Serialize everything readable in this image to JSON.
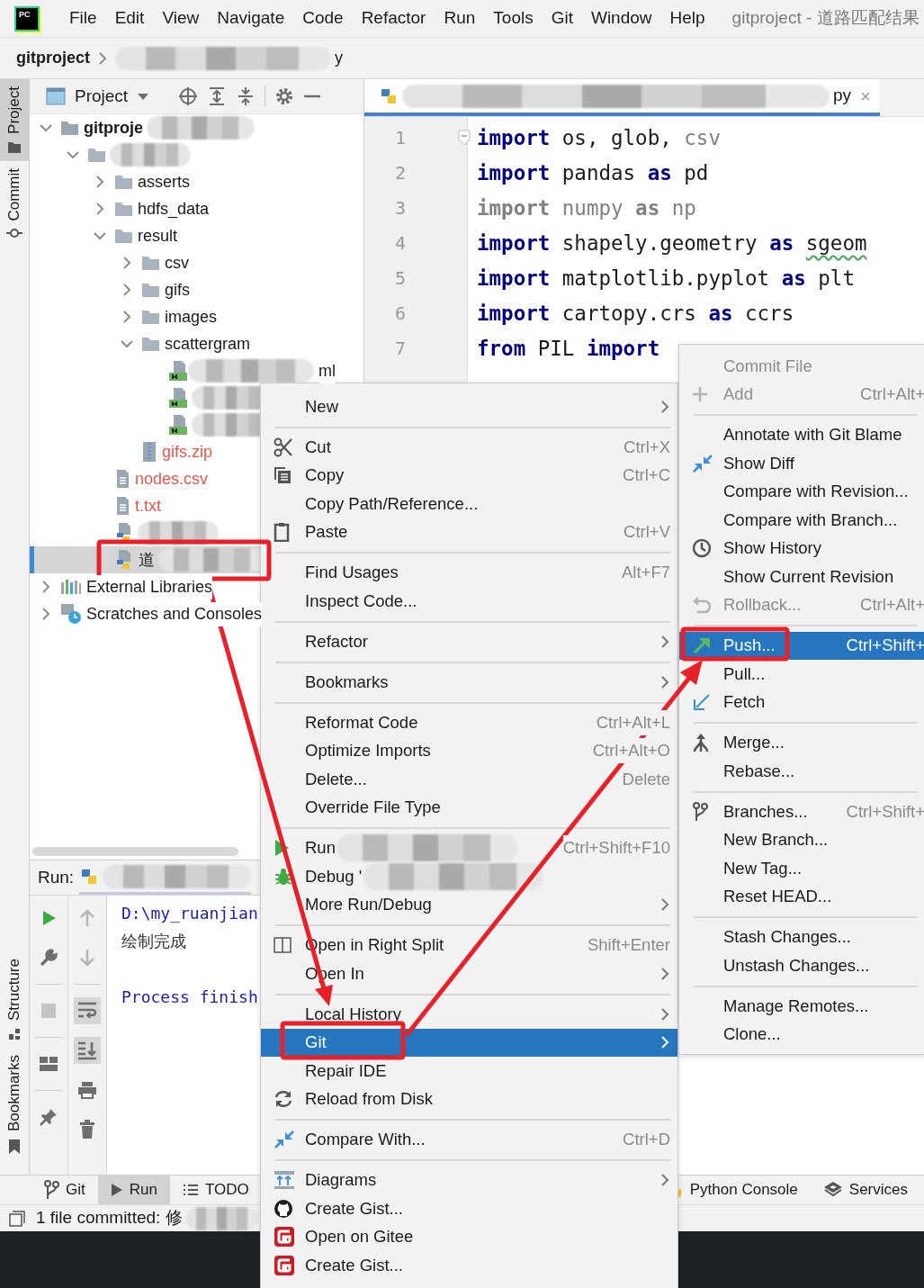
{
  "menu_bar": {
    "logo_text": "PC",
    "items": [
      "File",
      "Edit",
      "View",
      "Navigate",
      "Code",
      "Refactor",
      "Run",
      "Tools",
      "Git",
      "Window",
      "Help"
    ],
    "title": "gitproject - 道路匹配结果"
  },
  "breadcrumb": [
    {
      "label": "gitproject"
    },
    {
      "label": "y",
      "redacted_before": true
    }
  ],
  "left_toolbar": {
    "top": [
      {
        "label": "Project",
        "selected": true
      },
      {
        "label": "Commit",
        "selected": false
      }
    ],
    "bottom": [
      {
        "label": "Structure"
      },
      {
        "label": "Bookmarks"
      }
    ]
  },
  "project_panel": {
    "title": "Project",
    "tree": [
      {
        "label": "gitproje",
        "kind": "project",
        "expanded": true,
        "selected": false,
        "redacted_after": true,
        "children": [
          {
            "kind": "folder",
            "expanded": true,
            "selected": false,
            "redacted_after": true,
            "children": [
              {
                "label": "asserts",
                "kind": "folder",
                "expanded": false,
                "selected": false
              },
              {
                "label": "hdfs_data",
                "kind": "folder",
                "expanded": false,
                "selected": false
              },
              {
                "label": "result",
                "kind": "folder",
                "expanded": true,
                "selected": false,
                "children": [
                  {
                    "label": "csv",
                    "kind": "folder",
                    "expanded": false,
                    "selected": false
                  },
                  {
                    "label": "gifs",
                    "kind": "folder",
                    "expanded": false,
                    "selected": false
                  },
                  {
                    "label": "images",
                    "kind": "folder",
                    "expanded": false,
                    "selected": false
                  },
                  {
                    "label": "scattergram",
                    "kind": "folder",
                    "expanded": true,
                    "selected": false,
                    "children": [
                      {
                        "label": "ml",
                        "kind": "html",
                        "selected": false,
                        "redacted_before": true
                      },
                      {
                        "kind": "html",
                        "selected": false,
                        "redacted_after": true
                      },
                      {
                        "kind": "html",
                        "selected": false,
                        "redacted_after": true
                      }
                    ]
                  },
                  {
                    "label": "gifs.zip",
                    "kind": "zip",
                    "selected": false,
                    "color": "#e5574d"
                  }
                ]
              },
              {
                "label": "nodes.csv",
                "kind": "text",
                "selected": false,
                "color": "#e5574d"
              },
              {
                "label": "t.txt",
                "kind": "text",
                "selected": false,
                "color": "#e5574d"
              },
              {
                "kind": "python",
                "selected": false,
                "redacted_after": true
              },
              {
                "label": "道",
                "kind": "python",
                "selected": true,
                "redacted_after": true
              }
            ]
          }
        ]
      },
      {
        "label": "External Libraries",
        "kind": "library",
        "expanded": false,
        "selected": false
      },
      {
        "label": "Scratches and Consoles",
        "kind": "scratch",
        "expanded": false,
        "selected": false
      }
    ]
  },
  "editor": {
    "tab": {
      "label": "py",
      "close": "×",
      "redacted_before": true
    },
    "lines": [
      {
        "number": "1",
        "tokens": [
          {
            "text": "import",
            "kind": "keyword"
          },
          {
            "text": " os, glob, ",
            "kind": "plain"
          },
          {
            "text": "csv",
            "kind": "unused"
          }
        ]
      },
      {
        "number": "2",
        "tokens": [
          {
            "text": "import",
            "kind": "keyword"
          },
          {
            "text": " pandas ",
            "kind": "plain"
          },
          {
            "text": "as",
            "kind": "keyword"
          },
          {
            "text": " pd",
            "kind": "plain"
          }
        ]
      },
      {
        "number": "3",
        "tokens": [
          {
            "text": "import",
            "kind": "unused_keyword"
          },
          {
            "text": " numpy ",
            "kind": "unused"
          },
          {
            "text": "as",
            "kind": "unused_keyword"
          },
          {
            "text": " np",
            "kind": "unused"
          }
        ]
      },
      {
        "number": "4",
        "tokens": [
          {
            "text": "import",
            "kind": "keyword"
          },
          {
            "text": " shapely.geometry ",
            "kind": "plain"
          },
          {
            "text": "as ",
            "kind": "keyword"
          },
          {
            "text": "sgeom",
            "kind": "warning"
          }
        ]
      },
      {
        "number": "5",
        "tokens": [
          {
            "text": "import",
            "kind": "keyword"
          },
          {
            "text": " matplotlib.pyplot ",
            "kind": "plain"
          },
          {
            "text": "as",
            "kind": "keyword"
          },
          {
            "text": " plt",
            "kind": "plain"
          }
        ]
      },
      {
        "number": "6",
        "tokens": [
          {
            "text": "import",
            "kind": "keyword"
          },
          {
            "text": " cartopy.crs ",
            "kind": "plain"
          },
          {
            "text": "as",
            "kind": "keyword"
          },
          {
            "text": " ccrs",
            "kind": "plain"
          }
        ]
      },
      {
        "number": "7",
        "tokens": [
          {
            "text": "from",
            "kind": "keyword"
          },
          {
            "text": " PIL ",
            "kind": "plain"
          },
          {
            "text": "import",
            "kind": "keyword"
          }
        ]
      }
    ]
  },
  "run_panel": {
    "title": "Run:",
    "console": [
      {
        "text": "D:\\my_ruanjian",
        "kind": "path"
      },
      {
        "text": "绘制完成",
        "kind": "output"
      },
      {
        "text": "Process finish",
        "kind": "info"
      }
    ]
  },
  "bottom_tool_bar": {
    "left": [
      {
        "label": "Git",
        "selected": false
      },
      {
        "label": "Run",
        "selected": true
      },
      {
        "label": "TODO",
        "selected": false
      }
    ],
    "right": [
      {
        "label": "Python Console",
        "selected": false
      },
      {
        "label": "Services",
        "selected": false
      }
    ]
  },
  "status_bar": {
    "text": "1 file committed: 修"
  },
  "context_menu": {
    "items": [
      {
        "kind": "item",
        "label": "New",
        "submenu": true,
        "selected": false
      },
      {
        "kind": "separator"
      },
      {
        "kind": "item",
        "label": "Cut",
        "shortcut": "Ctrl+X",
        "submenu": false,
        "selected": false
      },
      {
        "kind": "item",
        "label": "Copy",
        "shortcut": "Ctrl+C",
        "submenu": false,
        "selected": false
      },
      {
        "kind": "item",
        "label": "Copy Path/Reference...",
        "submenu": false,
        "selected": false
      },
      {
        "kind": "item",
        "label": "Paste",
        "shortcut": "Ctrl+V",
        "submenu": false,
        "selected": false
      },
      {
        "kind": "separator"
      },
      {
        "kind": "item",
        "label": "Find Usages",
        "shortcut": "Alt+F7",
        "submenu": false,
        "selected": false
      },
      {
        "kind": "item",
        "label": "Inspect Code...",
        "submenu": false,
        "selected": false
      },
      {
        "kind": "separator"
      },
      {
        "kind": "item",
        "label": "Refactor",
        "submenu": true,
        "selected": false
      },
      {
        "kind": "separator"
      },
      {
        "kind": "item",
        "label": "Bookmarks",
        "submenu": true,
        "selected": false
      },
      {
        "kind": "separator"
      },
      {
        "kind": "item",
        "label": "Reformat Code",
        "shortcut": "Ctrl+Alt+L",
        "submenu": false,
        "selected": false
      },
      {
        "kind": "item",
        "label": "Optimize Imports",
        "shortcut": "Ctrl+Alt+O",
        "submenu": false,
        "selected": false
      },
      {
        "kind": "item",
        "label": "Delete...",
        "shortcut": "Delete",
        "submenu": false,
        "selected": false
      },
      {
        "kind": "item",
        "label": "Override File Type",
        "submenu": false,
        "selected": false
      },
      {
        "kind": "separator"
      },
      {
        "kind": "item",
        "label": "Run",
        "shortcut": "Ctrl+Shift+F10",
        "submenu": false,
        "selected": false,
        "redacted_after": true
      },
      {
        "kind": "item",
        "label": "Debug '",
        "submenu": false,
        "selected": false,
        "redacted_after": true
      },
      {
        "kind": "item",
        "label": "More Run/Debug",
        "submenu": true,
        "selected": false
      },
      {
        "kind": "separator"
      },
      {
        "kind": "item",
        "label": "Open in Right Split",
        "shortcut": "Shift+Enter",
        "submenu": false,
        "selected": false
      },
      {
        "kind": "item",
        "label": "Open In",
        "submenu": true,
        "selected": false
      },
      {
        "kind": "separator"
      },
      {
        "kind": "item",
        "label": "Local History",
        "submenu": true,
        "selected": false
      },
      {
        "kind": "item",
        "label": "Git",
        "submenu": true,
        "selected": true
      },
      {
        "kind": "item",
        "label": "Repair IDE",
        "submenu": false,
        "selected": false
      },
      {
        "kind": "item",
        "label": "Reload from Disk",
        "submenu": false,
        "selected": false
      },
      {
        "kind": "separator"
      },
      {
        "kind": "item",
        "label": "Compare With...",
        "shortcut": "Ctrl+D",
        "submenu": false,
        "selected": false
      },
      {
        "kind": "separator"
      },
      {
        "kind": "item",
        "label": "Diagrams",
        "submenu": true,
        "selected": false
      },
      {
        "kind": "item",
        "label": "Create Gist...",
        "submenu": false,
        "selected": false
      },
      {
        "kind": "item",
        "label": "Open on Gitee",
        "submenu": false,
        "selected": false
      },
      {
        "kind": "item",
        "label": "Create Gist...",
        "submenu": false,
        "selected": false
      }
    ]
  },
  "git_submenu": {
    "items": [
      {
        "kind": "item",
        "label": "Commit File",
        "disabled": true,
        "selected": false
      },
      {
        "kind": "item",
        "label": "Add",
        "shortcut": "Ctrl+Alt+",
        "disabled": true,
        "selected": false
      },
      {
        "kind": "separator"
      },
      {
        "kind": "item",
        "label": "Annotate with Git Blame",
        "disabled": false,
        "selected": false
      },
      {
        "kind": "item",
        "label": "Show Diff",
        "disabled": false,
        "selected": false
      },
      {
        "kind": "item",
        "label": "Compare with Revision...",
        "disabled": false,
        "selected": false
      },
      {
        "kind": "item",
        "label": "Compare with Branch...",
        "disabled": false,
        "selected": false
      },
      {
        "kind": "item",
        "label": "Show History",
        "disabled": false,
        "selected": false
      },
      {
        "kind": "item",
        "label": "Show Current Revision",
        "disabled": false,
        "selected": false
      },
      {
        "kind": "item",
        "label": "Rollback...",
        "shortcut": "Ctrl+Alt+",
        "disabled": true,
        "selected": false
      },
      {
        "kind": "separator"
      },
      {
        "kind": "item",
        "label": "Push...",
        "shortcut": "Ctrl+Shift+",
        "disabled": false,
        "selected": true
      },
      {
        "kind": "item",
        "label": "Pull...",
        "disabled": false,
        "selected": false
      },
      {
        "kind": "item",
        "label": "Fetch",
        "disabled": false,
        "selected": false
      },
      {
        "kind": "separator"
      },
      {
        "kind": "item",
        "label": "Merge...",
        "disabled": false,
        "selected": false
      },
      {
        "kind": "item",
        "label": "Rebase...",
        "disabled": false,
        "selected": false
      },
      {
        "kind": "separator"
      },
      {
        "kind": "item",
        "label": "Branches...",
        "shortcut": "Ctrl+Shift+",
        "disabled": false,
        "selected": false
      },
      {
        "kind": "item",
        "label": "New Branch...",
        "disabled": false,
        "selected": false
      },
      {
        "kind": "item",
        "label": "New Tag...",
        "disabled": false,
        "selected": false
      },
      {
        "kind": "item",
        "label": "Reset HEAD...",
        "disabled": false,
        "selected": false
      },
      {
        "kind": "separator"
      },
      {
        "kind": "item",
        "label": "Stash Changes...",
        "disabled": false,
        "selected": false
      },
      {
        "kind": "item",
        "label": "Unstash Changes...",
        "disabled": false,
        "selected": false
      },
      {
        "kind": "separator"
      },
      {
        "kind": "item",
        "label": "Manage Remotes...",
        "disabled": false,
        "selected": false
      },
      {
        "kind": "item",
        "label": "Clone...",
        "disabled": false,
        "selected": false
      }
    ]
  }
}
